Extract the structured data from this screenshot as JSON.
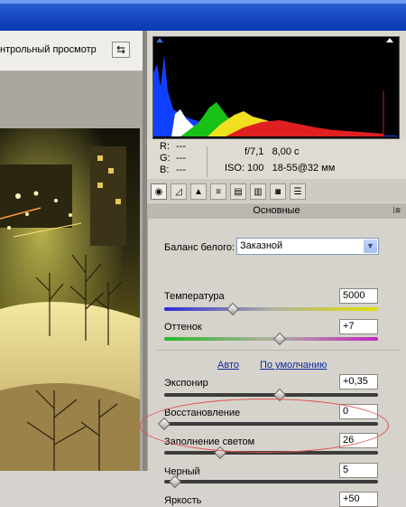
{
  "toolbar": {
    "preview_label": "нтрольный просмотр",
    "preview_toggle_icon": "swap-arrow-icon"
  },
  "readout": {
    "r_label": "R:",
    "r_value": "---",
    "g_label": "G:",
    "g_value": "---",
    "b_label": "B:",
    "b_value": "---",
    "aperture": "f/7,1",
    "shutter": "8,00 с",
    "iso": "ISO: 100",
    "lens": "18-55@32 мм"
  },
  "tabs": [
    {
      "icon": "basic-settings-icon"
    },
    {
      "icon": "tone-curve-icon"
    },
    {
      "icon": "detail-icon"
    },
    {
      "icon": "hsl-grayscale-icon"
    },
    {
      "icon": "split-toning-icon"
    },
    {
      "icon": "lens-corrections-icon"
    },
    {
      "icon": "camera-calibration-icon"
    },
    {
      "icon": "presets-icon"
    }
  ],
  "section": {
    "title": "Основные",
    "menu_icon": "panel-menu-icon"
  },
  "white_balance": {
    "label": "Баланс белого:",
    "value": "Заказной"
  },
  "sliders": {
    "temperature": {
      "label": "Температура",
      "value": "5000",
      "level": 0.32
    },
    "tint": {
      "label": "Оттенок",
      "value": "+7",
      "level": 0.54
    },
    "exposure": {
      "label": "Экспонир",
      "value": "+0,35",
      "level": 0.54
    },
    "recovery": {
      "label": "Восстановление",
      "value": "0",
      "level": 0.0
    },
    "fill_light": {
      "label": "Заполнение светом",
      "value": "26",
      "level": 0.26
    },
    "blacks": {
      "label": "Черный",
      "value": "5",
      "level": 0.05
    },
    "brightness": {
      "label": "Яркость",
      "value": "+50"
    }
  },
  "links": {
    "auto": "Авто",
    "default": "По умолчанию"
  },
  "colors": {
    "accent_link": "#0f2a9e",
    "highlight_ellipse": "#e15050"
  }
}
